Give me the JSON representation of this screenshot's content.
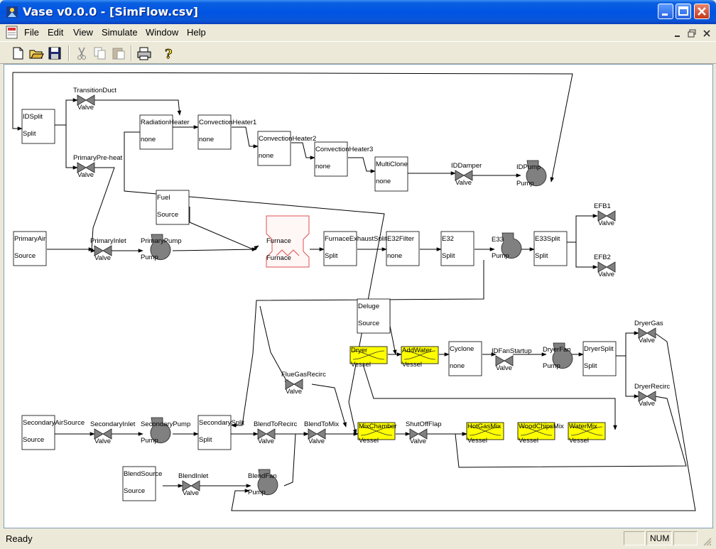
{
  "window": {
    "title": "Vase v0.0.0 - [SimFlow.csv]",
    "titlebar_color": "#0054e3"
  },
  "menu": {
    "items": [
      "File",
      "Edit",
      "View",
      "Simulate",
      "Window",
      "Help"
    ]
  },
  "toolbar": {
    "icons": [
      "new-file-icon",
      "open-folder-icon",
      "save-disk-icon",
      "cut-icon",
      "copy-icon",
      "paste-icon",
      "print-icon",
      "help-icon"
    ]
  },
  "colors": {
    "vessel_fill": "#ffff00",
    "furnace_stroke": "#e05050",
    "component_gray": "#808080"
  },
  "nodes": {
    "IDSplit": {
      "name": "IDSplit",
      "type": "Split"
    },
    "TransitionDuct": {
      "name": "TransitionDuct",
      "type": "Valve"
    },
    "PrimaryPreheat": {
      "name": "PrimaryPre-heat",
      "type": "Valve"
    },
    "RadiationHeater": {
      "name": "RadiationHeater",
      "type": "none"
    },
    "ConvectionHeater1": {
      "name": "ConvectionHeater1",
      "type": "none"
    },
    "ConvectionHeater2": {
      "name": "ConvectionHeater2",
      "type": "none"
    },
    "ConvectionHeater3": {
      "name": "ConvectionHeater3",
      "type": "none"
    },
    "MultiClone": {
      "name": "MultiClone",
      "type": "none"
    },
    "IDDamper": {
      "name": "IDDamper",
      "type": "Valve"
    },
    "IDPump": {
      "name": "IDPump",
      "type": "Pump"
    },
    "Fuel": {
      "name": "Fuel",
      "type": "Source"
    },
    "PrimaryAir": {
      "name": "PrimaryAir",
      "type": "Source"
    },
    "PrimaryInlet": {
      "name": "PrimaryInlet",
      "type": "Valve"
    },
    "PrimaryPump": {
      "name": "PrimaryPump",
      "type": "Pump"
    },
    "Furnace": {
      "name": "Furnace",
      "type": "Furnace"
    },
    "FurnaceExhaustSplit": {
      "name": "FurnaceExhaustSplit",
      "type": "Split"
    },
    "E32Filter": {
      "name": "E32Filter",
      "type": "none"
    },
    "E32": {
      "name": "E32",
      "type": "Split"
    },
    "E33": {
      "name": "E33",
      "type": "Pump"
    },
    "E33Split": {
      "name": "E33Split",
      "type": "Split"
    },
    "EFB1": {
      "name": "EFB1",
      "type": "Valve"
    },
    "EFB2": {
      "name": "EFB2",
      "type": "Valve"
    },
    "Deluge": {
      "name": "Deluge",
      "type": "Source"
    },
    "Dryer": {
      "name": "Dryer",
      "type": "Vessel"
    },
    "AddWater": {
      "name": "AddWater",
      "type": "Vessel"
    },
    "Cyclone": {
      "name": "Cyclone",
      "type": "none"
    },
    "IDFanStartup": {
      "name": "IDFanStartup",
      "type": "Valve"
    },
    "DryerFan": {
      "name": "DryerFan",
      "type": "Pump"
    },
    "DryerSplit": {
      "name": "DryerSplit",
      "type": "Split"
    },
    "DryerGas": {
      "name": "DryerGas",
      "type": "Valve"
    },
    "DryerRecirc": {
      "name": "DryerRecirc",
      "type": "Valve"
    },
    "FlueGasRecirc": {
      "name": "FlueGasRecirc",
      "type": "Valve"
    },
    "SecondaryAirSource": {
      "name": "SecondaryAirSource",
      "type": "Source"
    },
    "SecondaryInlet": {
      "name": "SecondaryInlet",
      "type": "Valve"
    },
    "SecondaryPump": {
      "name": "SecondaryPump",
      "type": "Pump"
    },
    "SecondarySplit": {
      "name": "SecondarySplit",
      "type": "Split"
    },
    "BlendToRecirc": {
      "name": "BlendToRecirc",
      "type": "Valve"
    },
    "BlendToMix": {
      "name": "BlendToMix",
      "type": "Valve"
    },
    "MixChamber": {
      "name": "MixChamber",
      "type": "Vessel"
    },
    "ShutOffFlap": {
      "name": "ShutOffFlap",
      "type": "Valve"
    },
    "HotGasMix": {
      "name": "HotGasMix",
      "type": "Vessel"
    },
    "WoodChipsMix": {
      "name": "WoodChipsMix",
      "type": "Vessel"
    },
    "WaterMix": {
      "name": "WaterMix",
      "type": "Vessel"
    },
    "BlendSource": {
      "name": "BlendSource",
      "type": "Source"
    },
    "BlendInlet": {
      "name": "BlendInlet",
      "type": "Valve"
    },
    "BlendFan": {
      "name": "BlendFan",
      "type": "Pump"
    }
  },
  "status": {
    "text": "Ready",
    "num": "NUM"
  }
}
